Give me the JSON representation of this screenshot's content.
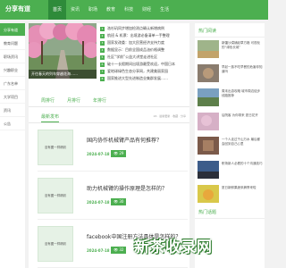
{
  "header": {
    "logo": "分享有道",
    "nav": [
      "首页",
      "资讯",
      "职场",
      "教育",
      "科技",
      "财经",
      "生活"
    ]
  },
  "sidebar": {
    "items": [
      "分享有道",
      "教育问题",
      "职场资讯",
      "兴趣职业",
      "广东名单",
      "大学项目",
      "资讯",
      "公告"
    ]
  },
  "hero": {
    "caption": "开往春天的列车穿越花海……"
  },
  "headlines": [
    "洛杉矶同步增加检测点确认新增病例",
    "航班 & 机票：出境游必备清单一手整理",
    "国家发改委：加大民营经济支持力度",
    "数据显示：目前全国成品油价格调整",
    "社区“学前”公益大讲堂走进社区",
    "破十一长假期间出境游最受欢迎，中国日本",
    "爱地球绿色生态分享网，共建美丽家园",
    "国家推进大型先进制造业集群发展……"
  ],
  "tabs": [
    "周排行",
    "月排行",
    "年排行"
  ],
  "section": {
    "title": "最新发布",
    "meta": "24 · 最新更新 · 收藏 · 分享"
  },
  "articles": [
    {
      "thumb": "没有图一样精彩",
      "title": "国内协作机械臂产品有何推荐？",
      "date": "2024-07-18",
      "views": "29"
    },
    {
      "thumb": "没有图一样精彩",
      "title": "助力机械臂的操作原理是怎样的？",
      "date": "2024-07-18",
      "views": "30"
    },
    {
      "thumb": "没有图一样精彩",
      "title": "facebook中国注册方法具体是怎样的？",
      "date": "2024-07-18",
      "views": "32"
    }
  ],
  "right": {
    "hot_title": "热门阅读",
    "hot_items": [
      "新疆沙漠铺起草方格 可视化的“绿色长城”",
      "早起一族不吃早餐的危害你知道吗",
      "周末出游攻略 城市周边徒步线路推荐",
      "后院客 为你带来 夏日花开",
      "一个人走过千山万水 最后都会回到自己心里",
      "职场新人必看的十个沟通技巧",
      "夏日新鲜果蔬采摘季来啦"
    ],
    "topics_title": "热门话题"
  },
  "watermark": "新茶收录网"
}
